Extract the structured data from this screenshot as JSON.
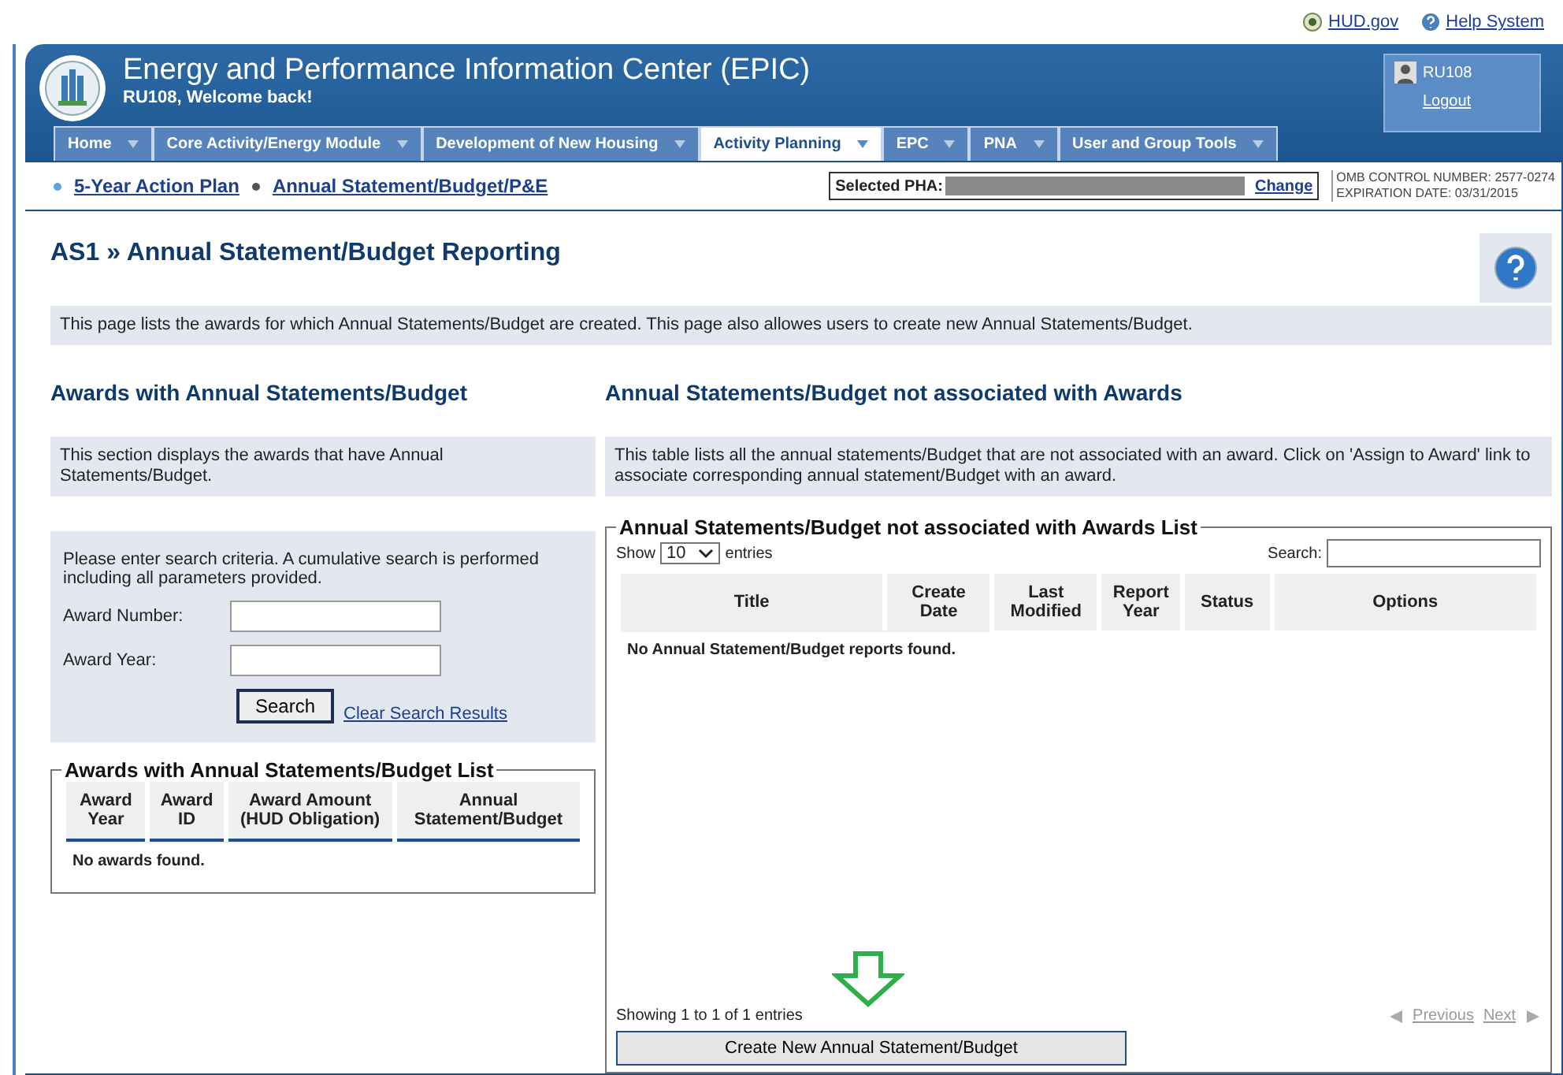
{
  "top_links": [
    {
      "kind": "seal",
      "label": "HUD.gov"
    },
    {
      "kind": "help",
      "label": "Help System"
    }
  ],
  "header": {
    "title": "Energy and Performance Information Center (EPIC)",
    "welcome": "RU108, Welcome back!",
    "user": "RU108",
    "logout": "Logout"
  },
  "tabs": [
    {
      "label": "Home",
      "selected": false
    },
    {
      "label": "Core Activity/Energy Module",
      "selected": false
    },
    {
      "label": "Development of New Housing",
      "selected": false
    },
    {
      "label": "Activity Planning",
      "selected": true
    },
    {
      "label": "EPC",
      "selected": false
    },
    {
      "label": "PNA",
      "selected": false
    },
    {
      "label": "User and Group Tools",
      "selected": false
    }
  ],
  "subnav": [
    {
      "label": "5-Year Action Plan",
      "selected": false
    },
    {
      "label": "Annual Statement/Budget/P&E",
      "selected": true
    }
  ],
  "pha": {
    "label": "Selected PHA:",
    "action": "Change"
  },
  "omb": [
    "OMB CONTROL NUMBER: 2577-0274",
    "EXPIRATION DATE: 03/31/2015"
  ],
  "page": {
    "title": "AS1 » Annual Statement/Budget Reporting",
    "description": "This page lists the awards for which Annual Statements/Budget are created. This page also allowes users to create new Annual Statements/Budget."
  },
  "left": {
    "heading": "Awards with Annual Statements/Budget",
    "description": "This section displays the awards that have Annual Statements/Budget.",
    "search": {
      "intro": "Please enter search criteria. A cumulative search is performed including all parameters provided.",
      "fields": [
        {
          "label": "Award Number:"
        },
        {
          "label": "Award Year:"
        }
      ],
      "button": "Search",
      "clear_link": "Clear Search Results"
    },
    "table": {
      "legend": "Awards with Annual Statements/Budget List",
      "columns": [
        "Award Year",
        "Award ID",
        "Award Amount (HUD Obligation)",
        "Annual Statement/Budget"
      ],
      "empty": "No awards found."
    }
  },
  "right": {
    "heading": "Annual Statements/Budget not associated with Awards",
    "description": "This table lists all the annual statements/Budget that are not associated with an award. Click on 'Assign to Award' link to associate corresponding annual statement/Budget with an award.",
    "table": {
      "legend": "Annual Statements/Budget not associated with Awards List",
      "show_label": "Show",
      "page_size": "10",
      "entries_label": "entries",
      "search_label": "Search:",
      "columns": [
        "Title",
        "Create Date",
        "Last Modified",
        "Report Year",
        "Status",
        "Options"
      ],
      "empty": "No Annual Statement/Budget reports found.",
      "info": "Showing 1 to 1 of 1 entries",
      "previous": "Previous",
      "next": "Next"
    },
    "create_button": "Create New Annual Statement/Budget"
  }
}
